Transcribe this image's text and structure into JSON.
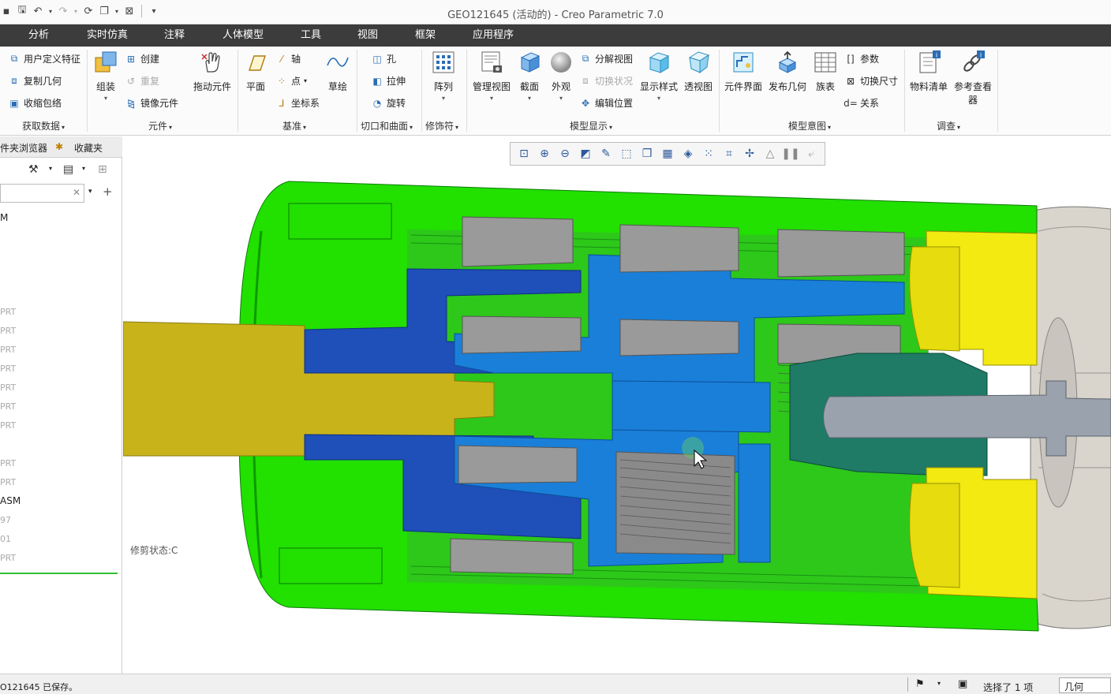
{
  "window": {
    "title": "GEO121645 (活动的) - Creo Parametric 7.0"
  },
  "tabs": [
    "分析",
    "实时仿真",
    "注释",
    "人体模型",
    "工具",
    "视图",
    "框架",
    "应用程序"
  ],
  "ribbon": {
    "get_data": {
      "items": [
        "用户定义特征",
        "复制几何",
        "收缩包络"
      ],
      "label": "获取数据"
    },
    "component": {
      "assemble": "组装",
      "create": "创建",
      "repeat": "重复",
      "mirror": "镜像元件",
      "drag": "拖动元件",
      "label": "元件"
    },
    "datum": {
      "plane": "平面",
      "axis": "轴",
      "point": "点",
      "csys": "坐标系",
      "sketch": "草绘",
      "label": "基准"
    },
    "cut_surface": {
      "hole": "孔",
      "extrude": "拉伸",
      "revolve": "旋转",
      "label": "切口和曲面"
    },
    "modifier": {
      "pattern": "阵列",
      "label": "修饰符"
    },
    "model_display": {
      "manage_views": "管理视图",
      "section": "截面",
      "appearance": "外观",
      "explode": "分解视图",
      "toggle_state": "切换状况",
      "edit_position": "编辑位置",
      "display_style": "显示样式",
      "perspective": "透视图",
      "label": "模型显示"
    },
    "model_intent": {
      "component_interface": "元件界面",
      "publish_geometry": "发布几何",
      "family_table": "族表",
      "params": "参数",
      "switch_dims": "切换尺寸",
      "relations": "关系",
      "label": "模型意图"
    },
    "investigate": {
      "bom": "物料清单",
      "reference_viewer_line1": "参考查看",
      "reference_viewer_line2": "器",
      "label": "调查"
    }
  },
  "left_panel": {
    "tab_folder": "件夹浏览器",
    "tab_favorites": "收藏夹",
    "tree": [
      "M",
      "PRT",
      "PRT",
      "PRT",
      "PRT",
      "PRT",
      "PRT",
      "PRT",
      "PRT",
      "PRT",
      "ASM",
      "97",
      "01",
      "PRT"
    ]
  },
  "graphics": {
    "trim_state": "修剪状态:C"
  },
  "status": {
    "message": "O121645 已保存。",
    "selection": "选择了 1 项",
    "filter": "几何"
  },
  "colors": {
    "tabbar": "#3c3c3c",
    "housing": "#22e000",
    "shaft": "#c8b41a",
    "gear_blue": "#1a7fd8",
    "gear_dark": "#1f4fb8",
    "gray": "#9a9a9a",
    "yellow": "#f2ea10",
    "teal": "#1f7a66"
  }
}
